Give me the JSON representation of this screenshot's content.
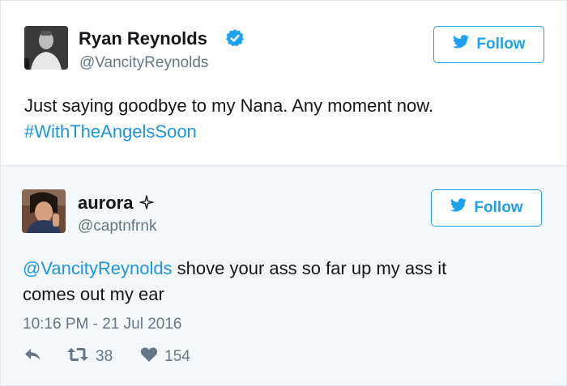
{
  "colors": {
    "twitter_blue": "#1da1f2",
    "link_blue": "#1b95e0",
    "verified_blue": "#1da1f2",
    "muted_gray": "#657786",
    "reply_bg": "#f5f8fa"
  },
  "original_tweet": {
    "author_name": "Ryan Reynolds",
    "verified": true,
    "verified_icon": "verified-badge-icon",
    "handle": "@VancityReynolds",
    "follow_label": "Follow",
    "follow_icon": "twitter-bird-icon",
    "text": "Just saying goodbye to my Nana. Any moment now.",
    "hashtag": "#WithTheAngelsSoon"
  },
  "reply_tweet": {
    "author_name": "aurora",
    "name_icon": "sparkle-icon",
    "handle": "@captnfrnk",
    "follow_label": "Follow",
    "follow_icon": "twitter-bird-icon",
    "mention": "@VancityReynolds",
    "text_line1": " shove your ass so far up my ass it",
    "text_line2": "comes out my ear",
    "timestamp": "10:16 PM - 21 Jul 2016",
    "actions": {
      "reply_icon": "reply-icon",
      "retweet_icon": "retweet-icon",
      "retweet_count": "38",
      "like_icon": "heart-icon",
      "like_count": "154"
    }
  }
}
